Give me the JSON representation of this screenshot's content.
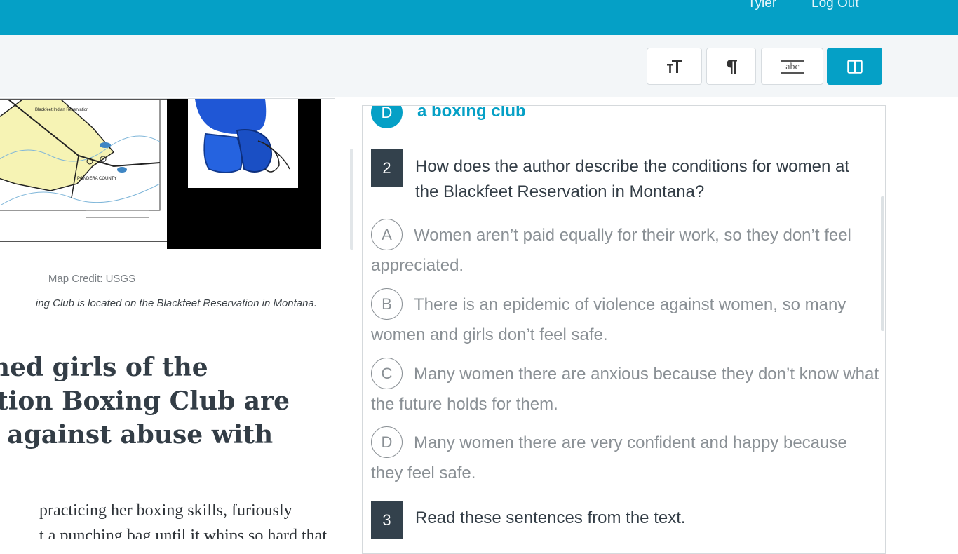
{
  "header": {
    "user_name": "Tyler",
    "logout_label": "Log Out"
  },
  "toolbar": {
    "buttons": [
      {
        "icon": "text-size-icon"
      },
      {
        "icon": "paragraph-icon"
      },
      {
        "icon": "strikethrough-abc-icon",
        "text": "abc"
      },
      {
        "icon": "split-view-icon",
        "active": true
      }
    ]
  },
  "article": {
    "map_credit": "Map Credit: USGS",
    "caption": "ing Club is located on the Blackfeet Reservation in Montana.",
    "headline_lines": [
      "ained girls of the",
      "vation Boxing Club are",
      "ck against abuse with"
    ],
    "body_lines": [
      "practicing her boxing skills, furiously",
      "t a punching bag until it whips so hard that"
    ],
    "map_labels": {
      "reservation": "Blackfeet Indian Reservation",
      "county": "PONDERA COUNTY"
    }
  },
  "questions": {
    "selected_answer": {
      "letter": "D",
      "text": "a boxing club"
    },
    "q2": {
      "number": "2",
      "text": "How does the author describe the conditions for women at the Blackfeet Reservation in Montana?",
      "options": [
        {
          "letter": "A",
          "text": "Women aren’t paid equally for their work, so they don’t feel appreciated."
        },
        {
          "letter": "B",
          "text": "There is an epidemic of violence against women, so many women and girls don’t feel safe."
        },
        {
          "letter": "C",
          "text": "Many women there are anxious because they don’t know what the future holds for them."
        },
        {
          "letter": "D",
          "text": "Many women there are very confident and happy because they feel safe."
        }
      ]
    },
    "q3": {
      "number": "3",
      "text": "Read these sentences from the text."
    }
  },
  "colors": {
    "brand": "#05a0c6",
    "question_number_bg": "#33414c"
  }
}
